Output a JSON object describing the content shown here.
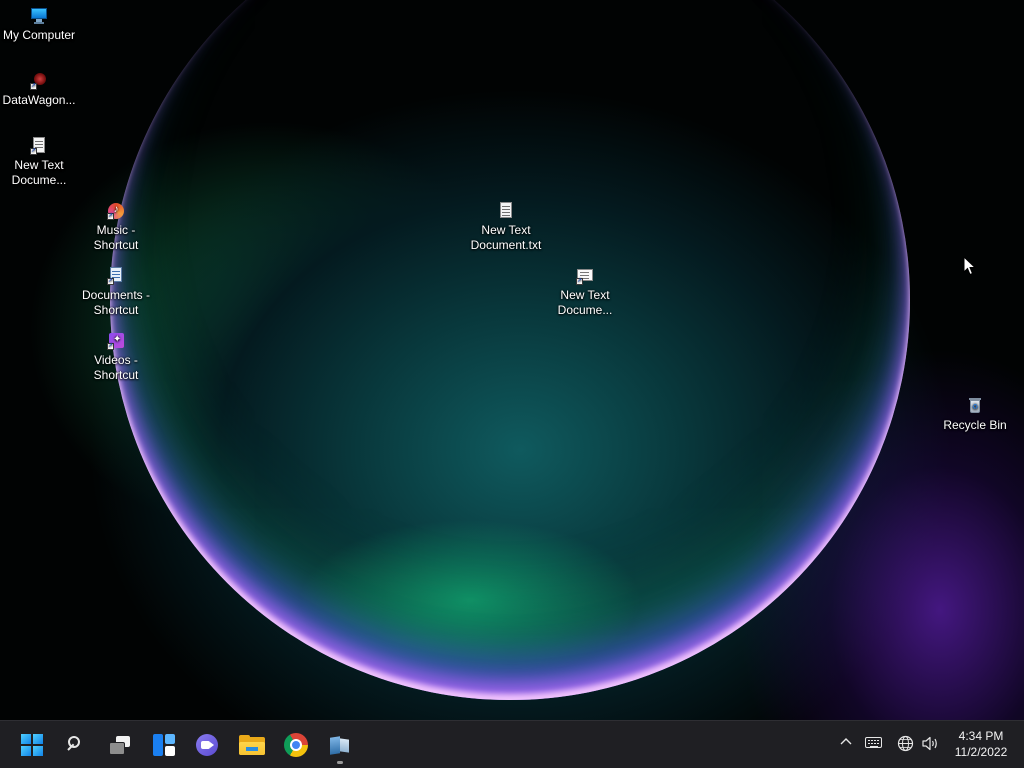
{
  "desktop": {
    "icons": [
      {
        "label": "My Computer",
        "icon": "monitor-icon"
      },
      {
        "label": "DataWagon...",
        "icon": "datawagon-icon"
      },
      {
        "label": "New Text\nDocume...",
        "icon": "text-document-shortcut-icon"
      },
      {
        "label": "Music -\nShortcut",
        "icon": "music-icon"
      },
      {
        "label": "Documents -\nShortcut",
        "icon": "documents-icon"
      },
      {
        "label": "Videos -\nShortcut",
        "icon": "videos-icon"
      },
      {
        "label": "New Text\nDocument.txt",
        "icon": "text-file-icon"
      },
      {
        "label": "New Text\nDocume...",
        "icon": "text-document-shortcut-icon"
      },
      {
        "label": "Recycle Bin",
        "icon": "recycle-bin-icon"
      }
    ]
  },
  "taskbar": {
    "apps": [
      {
        "name": "start",
        "icon": "windows-logo-icon"
      },
      {
        "name": "search",
        "icon": "search-icon"
      },
      {
        "name": "task-view",
        "icon": "task-view-icon"
      },
      {
        "name": "widgets",
        "icon": "widgets-icon"
      },
      {
        "name": "teams-chat",
        "icon": "teams-chat-icon"
      },
      {
        "name": "file-explorer",
        "icon": "folder-icon"
      },
      {
        "name": "chrome",
        "icon": "chrome-icon"
      },
      {
        "name": "app",
        "icon": "app-icon",
        "running": true
      }
    ],
    "tray": {
      "icons": [
        "chevron-up-icon",
        "keyboard-icon",
        "network-icon",
        "volume-icon"
      ],
      "time": "4:34 PM",
      "date": "11/2/2022"
    }
  },
  "colors": {
    "taskbar_bg": "#1f1f23",
    "accent": "#1183e8",
    "text": "#ffffff"
  }
}
